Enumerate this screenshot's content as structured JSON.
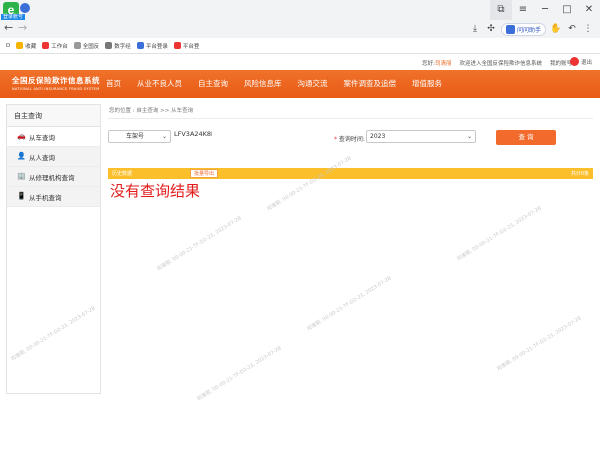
{
  "browser": {
    "logo_letter": "e",
    "login_tag": "登录账号",
    "back": "←",
    "forward": "→",
    "ai_label": "问问助手",
    "bookmarks": [
      "D",
      "收藏",
      "工作台",
      "全国反",
      "数字经",
      "平台登录",
      "平台登"
    ]
  },
  "site_top": {
    "greeting": "您好:",
    "user": "司清丽",
    "welcome": "欢迎进入全国反保险欺诈信息系统",
    "my_account": "我的账号",
    "exit": "退出"
  },
  "header": {
    "logo_cn": "全国反保险欺诈信息系统",
    "logo_en": "NATIONAL ANTI-INSURANCE FRAUD SYSTEM",
    "menu": [
      "首页",
      "从业不良人员",
      "自主查询",
      "风险信息库",
      "沟通交流",
      "案件调查及追偿",
      "增值服务"
    ]
  },
  "sidebar": {
    "title": "自主查询",
    "items": [
      {
        "label": "从车查询",
        "icon": "car-icon"
      },
      {
        "label": "从人查询",
        "icon": "person-icon"
      },
      {
        "label": "从修理机构查询",
        "icon": "repair-icon"
      },
      {
        "label": "从手机查询",
        "icon": "phone-icon"
      }
    ]
  },
  "main": {
    "breadcrumb": "您的位置 : 自主查询 >> 从车查询",
    "plate_type": "车架号",
    "plate_value": "LFV3A24K8M3",
    "year_label": "查询时间:",
    "year_required": "*",
    "year_value": "2023",
    "query_button": "查 询",
    "bar_left": "历史数据",
    "export_button": "批量导出",
    "bar_right": "共计0条",
    "no_result": "没有查询结果"
  },
  "watermark": "司清丽, 00-00-21-7F-D2-23, 2023-07-28",
  "colors": {
    "accent": "#f0722b",
    "bar": "#fbbf2b",
    "error": "#e31b1b"
  }
}
